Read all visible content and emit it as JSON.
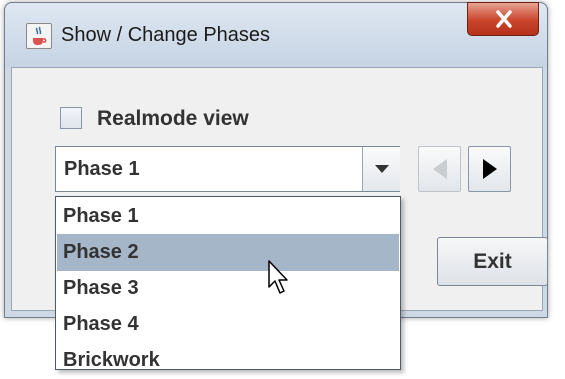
{
  "window": {
    "title": "Show / Change Phases",
    "icon": "java-coffee-cup-icon",
    "close_icon": "close-x-icon"
  },
  "realmode": {
    "label": "Realmode view",
    "checked": false
  },
  "phase_combo": {
    "selected": "Phase 1",
    "arrow_icon": "dropdown-triangle-icon"
  },
  "navigation": {
    "prev_icon": "left-arrow-icon",
    "prev_enabled": false,
    "next_icon": "right-arrow-icon",
    "next_enabled": true
  },
  "exit_button": {
    "label": "Exit"
  },
  "dropdown": {
    "options": [
      "Phase 1",
      "Phase 2",
      "Phase 3",
      "Phase 4",
      "Brickwork"
    ],
    "highlighted": "Phase 2"
  },
  "cursor": "mouse-pointer-icon",
  "colors": {
    "highlight": "#a5b6c8",
    "close_button": "#c9442b"
  }
}
